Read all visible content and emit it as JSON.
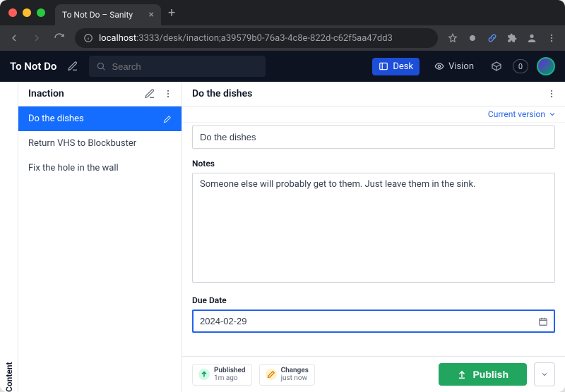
{
  "browser": {
    "tab_title": "To Not Do – Sanity",
    "host": "localhost",
    "port_path": ":3333/desk/inaction;a39579b0-76a3-4c8e-822d-c62f5aa47dd3"
  },
  "nav": {
    "brand": "To Not Do",
    "search_placeholder": "Search",
    "desk": "Desk",
    "vision": "Vision",
    "badge_count": "0"
  },
  "rail": {
    "label": "Content"
  },
  "list": {
    "title": "Inaction",
    "items": [
      {
        "label": "Do the dishes",
        "active": true
      },
      {
        "label": "Return VHS to Blockbuster",
        "active": false
      },
      {
        "label": "Fix the hole in the wall",
        "active": false
      }
    ]
  },
  "doc": {
    "title": "Do the dishes",
    "version_label": "Current version",
    "fields": {
      "title_value": "Do the dishes",
      "notes_label": "Notes",
      "notes_value": "Someone else will probably get to them. Just leave them in the sink.",
      "due_label": "Due Date",
      "due_value": "2024-02-29"
    }
  },
  "footer": {
    "published_label": "Published",
    "published_time": "1m ago",
    "changes_label": "Changes",
    "changes_time": "just now",
    "publish_button": "Publish"
  }
}
